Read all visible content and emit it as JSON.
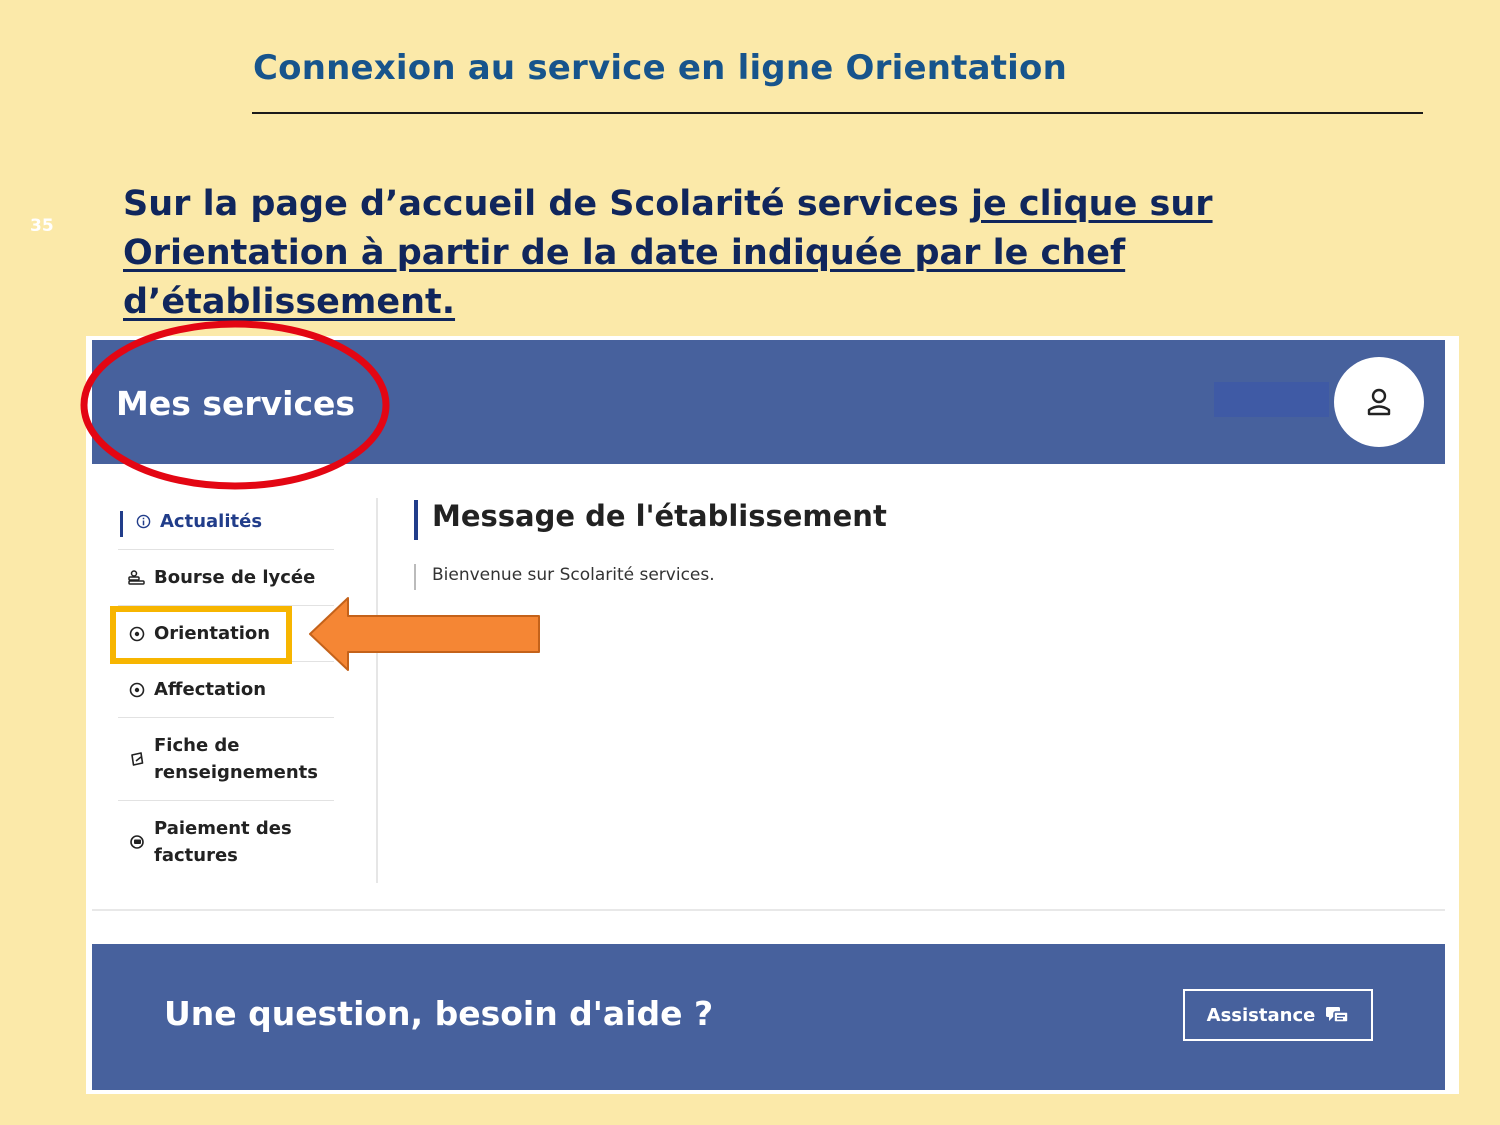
{
  "slide": {
    "title": "Connexion au service en ligne Orientation",
    "page_number": "35",
    "instruction_plain": "Sur la page d’accueil de Scolarité services ",
    "instruction_underlined": "je clique sur Orientation à partir de la date indiquée par le chef d’établissement."
  },
  "app": {
    "brand": "Mes services",
    "user_icon": "user-icon",
    "sidebar": {
      "items": [
        {
          "label": "Actualités",
          "icon": "info-circle-icon",
          "active": true
        },
        {
          "label": "Bourse de lycée",
          "icon": "scholarship-icon",
          "active": false
        },
        {
          "label": "Orientation",
          "icon": "compass-icon",
          "active": false
        },
        {
          "label": "Affectation",
          "icon": "compass-icon",
          "active": false
        },
        {
          "label_line1": "Fiche de",
          "label_line2": "renseignements",
          "icon": "edit-card-icon",
          "active": false
        },
        {
          "label_line1": "Paiement des",
          "label_line2": "factures",
          "icon": "payment-icon",
          "active": false
        }
      ]
    },
    "main": {
      "title": "Message de l'établissement",
      "text": "Bienvenue sur Scolarité services."
    },
    "footer": {
      "question": "Une question, besoin d'aide ?",
      "assistance_label": "Assistance",
      "assistance_icon": "chat-icon"
    }
  },
  "colors": {
    "slide_background": "#fbe9a9",
    "title_blue": "#17548c",
    "instruction_navy": "#10265c",
    "header_blue": "#47619d",
    "annotation_red": "#e30613",
    "highlight_yellow": "#f7b500",
    "arrow_orange": "#f58634"
  }
}
